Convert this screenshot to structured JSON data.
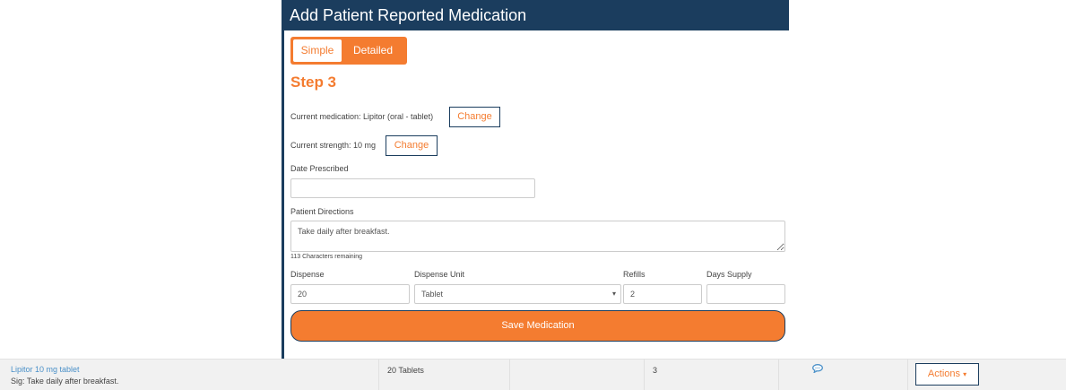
{
  "panel": {
    "title": "Add Patient Reported Medication",
    "mode_tabs": [
      {
        "label": "Simple"
      },
      {
        "label": "Detailed"
      }
    ],
    "step_title": "Step 3",
    "current_medication": {
      "text": "Current medication: Lipitor (oral - tablet)",
      "change_label": "Change"
    },
    "current_strength": {
      "text": "Current strength: 10 mg",
      "change_label": "Change"
    },
    "date_prescribed": {
      "label": "Date Prescribed",
      "value": ""
    },
    "patient_directions": {
      "label": "Patient Directions",
      "value": "Take daily after breakfast.",
      "chars_remaining": "113 Characters remaining"
    },
    "dispense": {
      "label": "Dispense",
      "value": "20"
    },
    "dispense_unit": {
      "label": "Dispense Unit",
      "value": "Tablet"
    },
    "refills": {
      "label": "Refills",
      "value": "2"
    },
    "days_supply": {
      "label": "Days Supply",
      "value": ""
    },
    "save_label": "Save Medication"
  },
  "medication_row": {
    "name": "Lipitor 10 mg tablet",
    "sig": "Sig: Take daily after breakfast.",
    "quantity": "20 Tablets",
    "refills": "3",
    "comment_icon": "comment-icon",
    "actions_label": "Actions"
  },
  "colors": {
    "header_bg": "#1b3d5e",
    "accent": "#f47c30",
    "link": "#4a90c8",
    "row_bg": "#f1f1f1"
  }
}
